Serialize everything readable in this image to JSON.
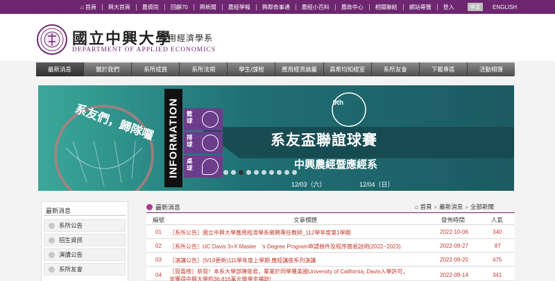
{
  "top_nav": {
    "items": [
      "首頁",
      "興大首頁",
      "農資院",
      "回顧70",
      "興新聞",
      "農經學報",
      "興鄰奇事通",
      "農經小百科",
      "農政中心",
      "相關聯結",
      "網站導覽",
      "登入"
    ],
    "lang_zh": "中文",
    "lang_en": "ENGLISH",
    "home_icon": "home-icon"
  },
  "header": {
    "cn_title": "國立中興大學",
    "cn_sub": "應用經濟學系",
    "en_title": "DEPARTMENT OF APPLIED ECONOMICS"
  },
  "main_nav": {
    "items": [
      "最新消息",
      "關於我們",
      "系所成員",
      "系所法規",
      "學生/課程",
      "應用經濟論叢",
      "高希均知經室",
      "系所友會",
      "下載專區",
      "活動相簿"
    ],
    "active": "最新消息"
  },
  "banner": {
    "slogan": "系友們，歸隊囉！",
    "info": "INFORMATION",
    "sports": [
      "籃球",
      "排球",
      "桌球"
    ],
    "edition": "9th",
    "title": "系友盃聯誼球賽",
    "subtitle": "中興農經暨應經系",
    "date1": "12/03（六）",
    "date2": "12/04（日）",
    "slide_count": 10,
    "active_slide": 2
  },
  "sidebar": {
    "title": "最新消息",
    "items": [
      "系所公告",
      "招生資訊",
      "演講公告",
      "系所友會"
    ]
  },
  "news": {
    "title": "最新消息",
    "breadcrumb": [
      "首頁",
      "最新消息",
      "全部新聞"
    ],
    "columns": [
      "編號",
      "文章標題",
      "發佈時間",
      "人氣"
    ],
    "rows": [
      {
        "no": "01",
        "title": "［系所公告］國立中興大學應用經濟學系徵聘專任教師_112學年度第1學期",
        "date": "2022-10-06",
        "views": "340"
      },
      {
        "no": "02",
        "title": "［系所公告］UC Davis 3+X Master　's Degree Program申請條件及程序簡易說明(2022~2023)",
        "date": "2022-09-27",
        "views": "87"
      },
      {
        "no": "03",
        "title": "［演講公告］(9/19更新)111學年度上學期 應經講座系列演講",
        "date": "2022-09-20",
        "views": "475"
      },
      {
        "no": "04",
        "title": "［賀喜榜］恭賀！本系大學部陳俊君，畢業於同學獲美國University of California, Davis入學許可，",
        "title2": "並獲得中興大學約36.816萬元獎學金補助!",
        "date": "2022-09-14",
        "views": "341"
      }
    ]
  },
  "colors": {
    "brand_purple": "#6e2670",
    "link_red": "#c0392b",
    "banner_teal": "#2a8a86"
  }
}
